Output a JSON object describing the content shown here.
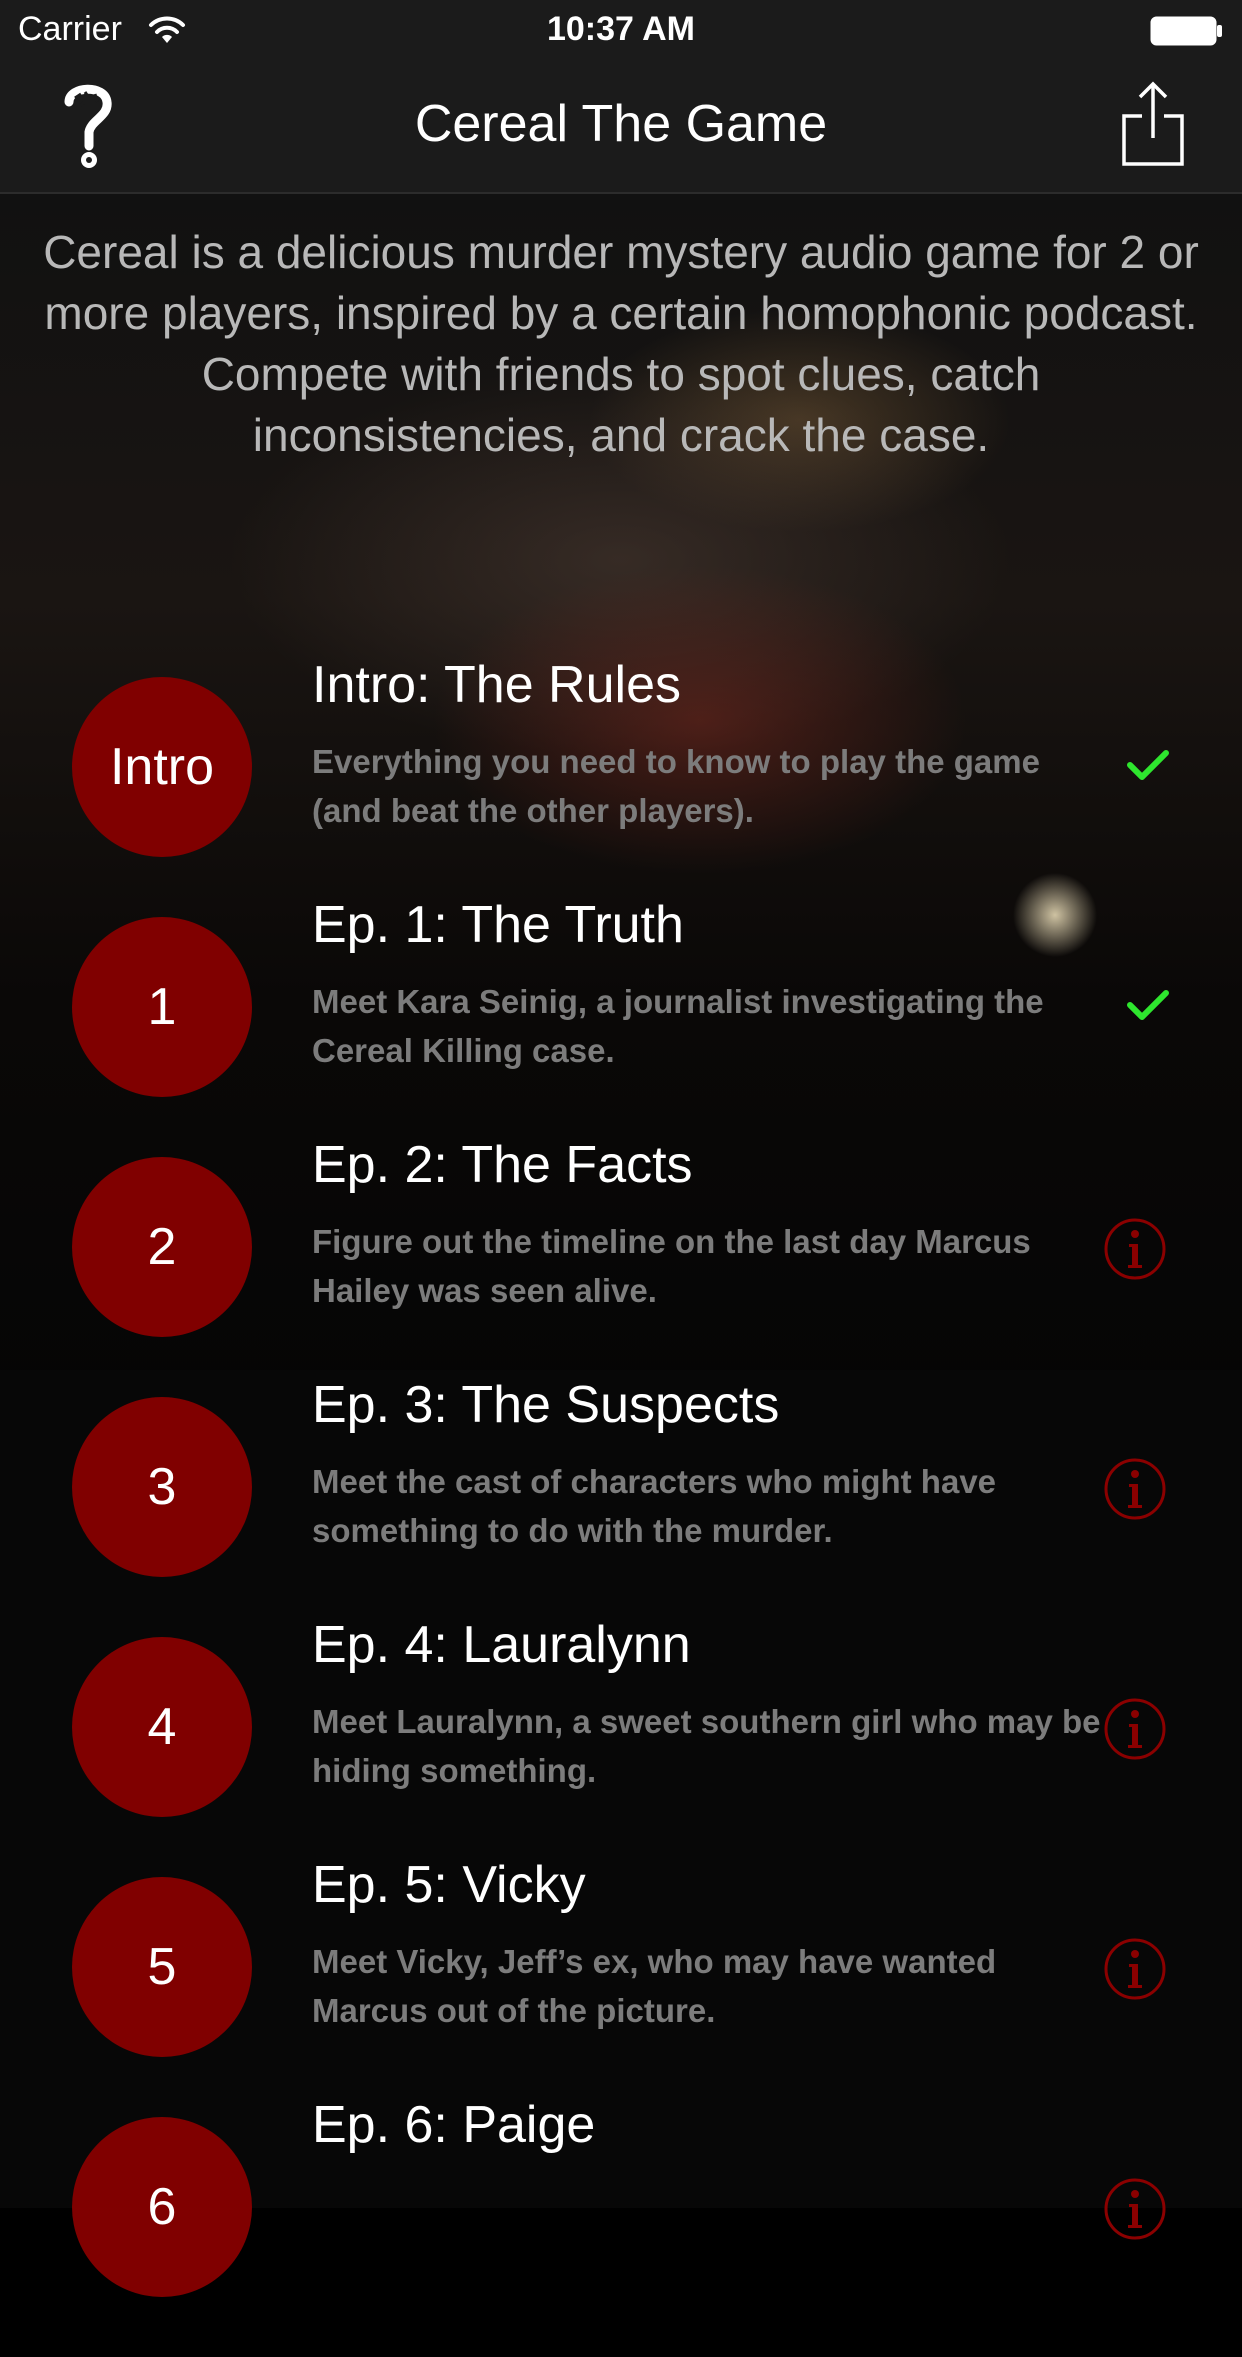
{
  "status_bar": {
    "carrier": "Carrier",
    "time": "10:37 AM"
  },
  "nav": {
    "title": "Cereal The Game",
    "left_icon": "question-mark-logo-icon",
    "right_icon": "share-icon"
  },
  "intro": {
    "text": "Cereal is a delicious murder mystery audio game for 2 or more players, inspired by a certain homophonic podcast. Compete with friends to spot clues, catch inconsistencies, and crack the case."
  },
  "colors": {
    "circle": "#800000",
    "check": "#2ee62e",
    "info": "#8b0000"
  },
  "episodes": [
    {
      "badge": "Intro",
      "title": "Intro: The Rules",
      "description": "Everything you need to know to play the game (and beat the other players).",
      "status": "check-icon"
    },
    {
      "badge": "1",
      "title": "Ep. 1: The Truth",
      "description": "Meet Kara Seinig, a journalist investigating the Cereal Killing case.",
      "status": "check-icon"
    },
    {
      "badge": "2",
      "title": "Ep. 2: The Facts",
      "description": "Figure out the timeline on the last day Marcus Hailey was seen alive.",
      "status": "info-icon"
    },
    {
      "badge": "3",
      "title": "Ep. 3: The Suspects",
      "description": "Meet the cast of characters who might have something to do with the murder.",
      "status": "info-icon"
    },
    {
      "badge": "4",
      "title": "Ep. 4: Lauralynn",
      "description": "Meet Lauralynn, a sweet southern girl who may be hiding something.",
      "status": "info-icon"
    },
    {
      "badge": "5",
      "title": "Ep. 5: Vicky",
      "description": "Meet Vicky, Jeff’s ex, who may have wanted Marcus out of the picture.",
      "status": "info-icon"
    },
    {
      "badge": "6",
      "title": "Ep. 6: Paige",
      "description": "",
      "status": "info-icon"
    }
  ]
}
